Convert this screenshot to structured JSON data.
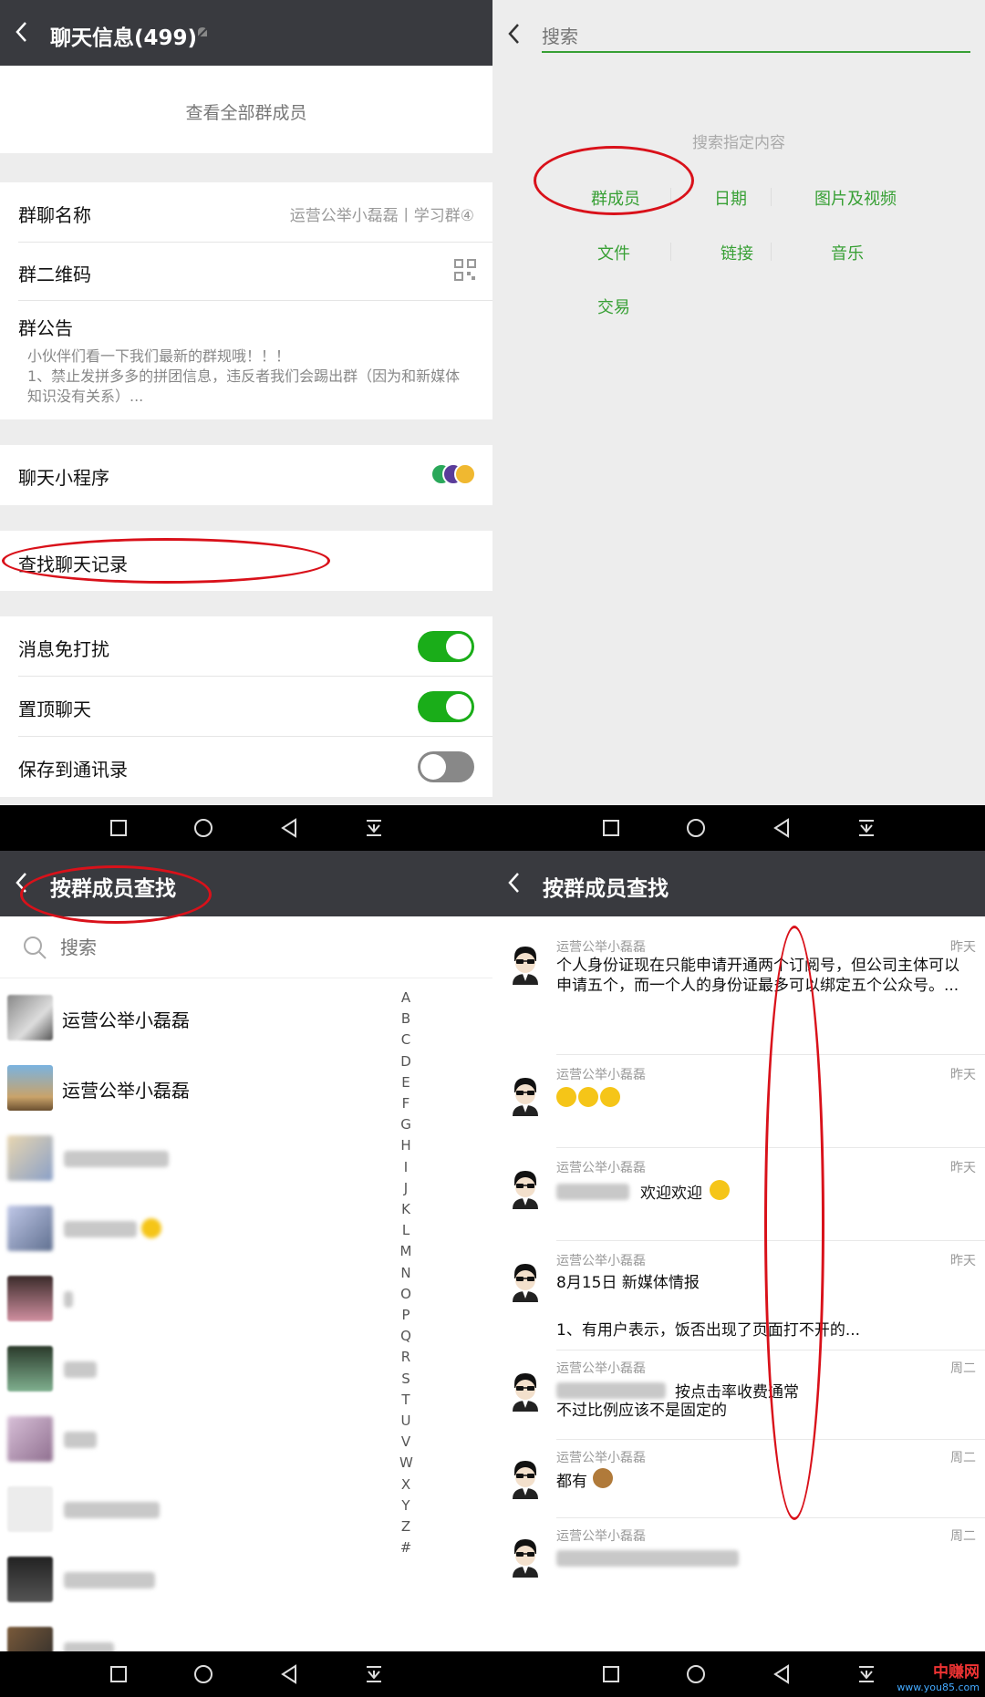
{
  "top_left": {
    "title": "聊天信息(499)",
    "view_all_members": "查看全部群成员",
    "group_name_label": "群聊名称",
    "group_name_value": "运营公举小磊磊丨学习群④",
    "qr_label": "群二维码",
    "notice_label": "群公告",
    "notice_text": "小伙伴们看一下我们最新的群规哦！！！\n1、禁止发拼多多的拼团信息，违反者我们会踢出群（因为和新媒体知识没有关系）...",
    "mini_program_label": "聊天小程序",
    "search_history_label": "查找聊天记录",
    "mute_label": "消息免打扰",
    "pin_label": "置顶聊天",
    "save_contacts_label": "保存到通讯录"
  },
  "top_right": {
    "search_placeholder": "搜索",
    "hint": "搜索指定内容",
    "options": [
      "群成员",
      "日期",
      "图片及视频",
      "文件",
      "链接",
      "音乐",
      "交易"
    ]
  },
  "bottom_left": {
    "title": "按群成员查找",
    "search_placeholder": "搜索",
    "members": [
      "运营公举小磊磊",
      "运营公举小磊磊"
    ],
    "alphabet": [
      "A",
      "B",
      "C",
      "D",
      "E",
      "F",
      "G",
      "H",
      "I",
      "J",
      "K",
      "L",
      "M",
      "N",
      "O",
      "P",
      "Q",
      "R",
      "S",
      "T",
      "U",
      "V",
      "W",
      "X",
      "Y",
      "Z",
      "#"
    ]
  },
  "bottom_right": {
    "title": "按群成员查找",
    "messages": [
      {
        "name": "运营公举小磊磊",
        "time": "昨天",
        "text": "个人身份证现在只能申请开通两个订阅号，但公司主体可以申请五个，而一个人的身份证最多可以绑定五个公众号。..."
      },
      {
        "name": "运营公举小磊磊",
        "time": "昨天",
        "text": ""
      },
      {
        "name": "运营公举小磊磊",
        "time": "昨天",
        "text": "欢迎欢迎"
      },
      {
        "name": "运营公举小磊磊",
        "time": "昨天",
        "text": "8月15日 新媒体情报",
        "text2": "1、有用户表示，饭否出现了页面打不开的..."
      },
      {
        "name": "运营公举小磊磊",
        "time": "周二",
        "text": "按点击率收费通常",
        "text2": "不过比例应该不是固定的"
      },
      {
        "name": "运营公举小磊磊",
        "time": "周二",
        "text": "都有"
      },
      {
        "name": "运营公举小磊磊",
        "time": "周二",
        "text": ""
      }
    ]
  },
  "watermark": {
    "line1": "中赚网",
    "line2": "www.you85.com"
  },
  "colors": {
    "nav": "#393a3f",
    "green": "#1aad19",
    "option_green": "#38a035",
    "annotation_red": "#d9111a"
  }
}
